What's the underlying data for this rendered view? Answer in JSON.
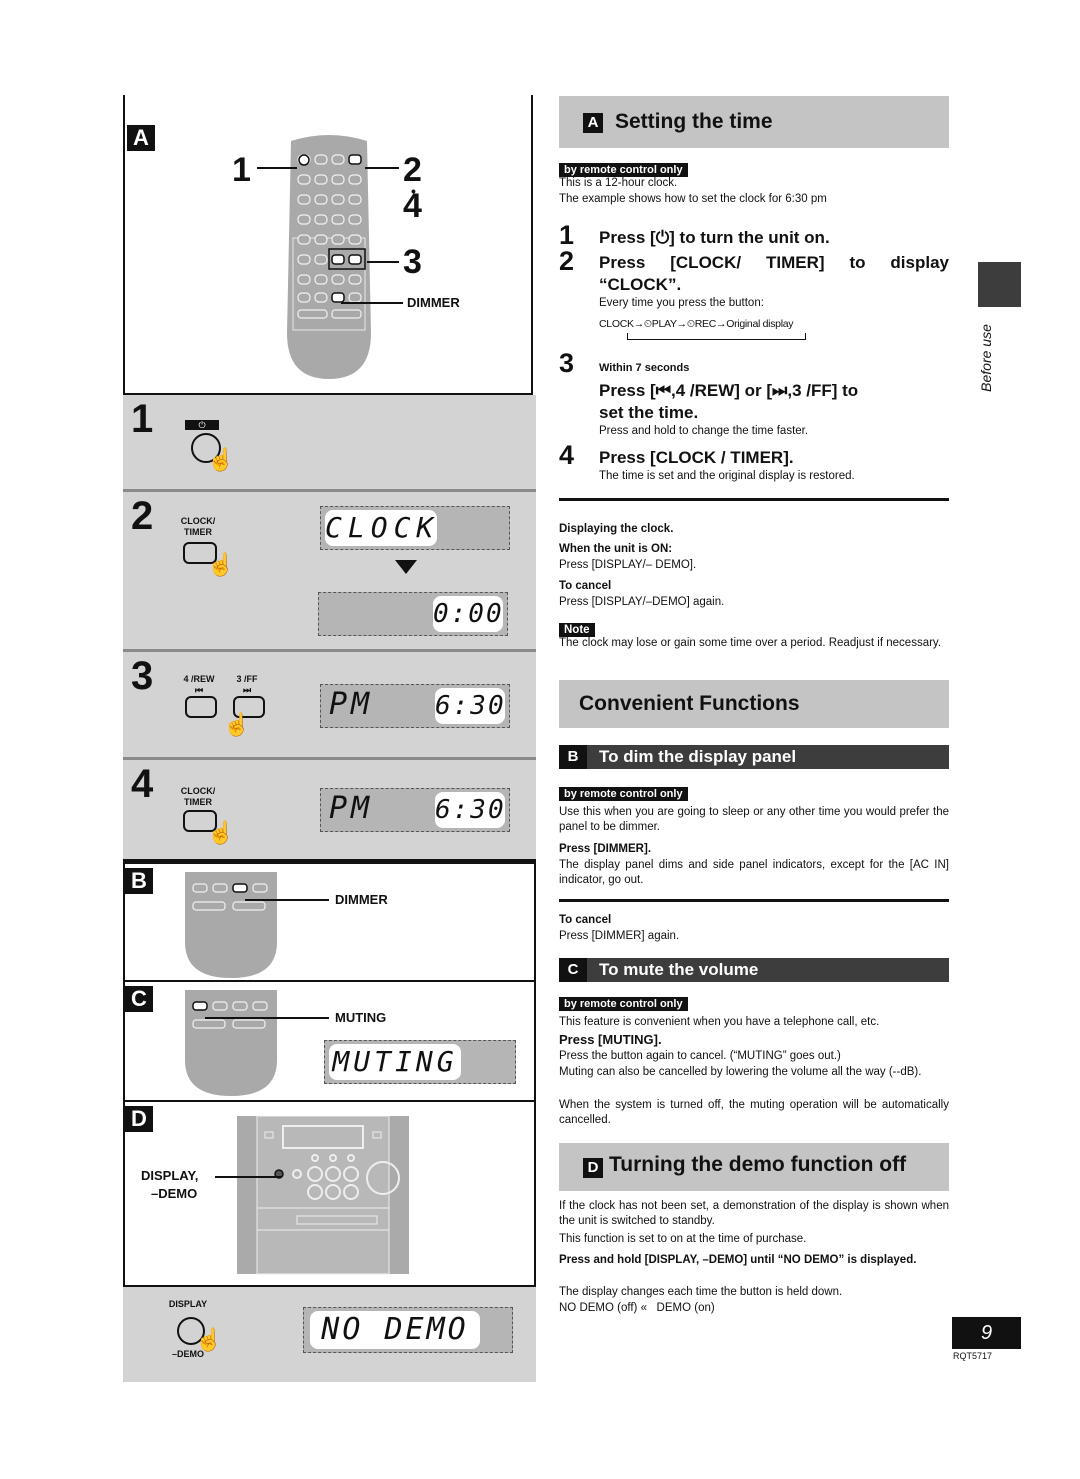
{
  "page": {
    "side_tab": "Before use",
    "page_number": "9",
    "doc_code": "RQT5717"
  },
  "illustrations": {
    "box_a": {
      "letter": "A",
      "callouts": [
        "1",
        "2",
        "4",
        "3"
      ],
      "dimmer_label": "DIMMER",
      "power_symbol": "⏻"
    },
    "steps": [
      {
        "num": "1",
        "button_label": "⏻"
      },
      {
        "num": "2",
        "button_label_line1": "CLOCK/",
        "button_label_line2": "TIMER",
        "display_1": "CLOCK",
        "display_2": "0:00"
      },
      {
        "num": "3",
        "btn_rew_label": "4 /REW",
        "btn_rew_icon": "⏮",
        "btn_ff_label": "3 /FF",
        "btn_ff_icon": "⏭",
        "display_left": "PM",
        "display_right": "6:30"
      },
      {
        "num": "4",
        "button_label_line1": "CLOCK/",
        "button_label_line2": "TIMER",
        "display_left": "PM",
        "display_right": "6:30"
      }
    ],
    "box_b": {
      "letter": "B",
      "callout": "DIMMER"
    },
    "box_c": {
      "letter": "C",
      "callout": "MUTING",
      "display": "MUTING"
    },
    "box_d": {
      "letter": "D",
      "callout_line1": "DISPLAY,",
      "callout_line2": "–DEMO"
    },
    "demo_step": {
      "label_top": "DISPLAY",
      "label_bottom": "–DEMO",
      "display": "NO DEMO"
    }
  },
  "setting_time": {
    "letter": "A",
    "title": "Setting the time",
    "tag": "by remote control only",
    "intro_1": "This is a 12-hour clock.",
    "intro_2": "The example shows how to set the clock for 6:30 pm",
    "step1_num": "1",
    "step1": "Press [⏻] to turn the unit on.",
    "step2_num": "2",
    "step2_a": "Press [CLOCK/ TIMER] to display",
    "step2_b": "“CLOCK”.",
    "step2_note": "Every time you press the button:",
    "cycle": [
      "CLOCK",
      "→",
      "⏲PLAY",
      "→",
      "⏲REC",
      "→",
      "Original display"
    ],
    "step3_num": "3",
    "step3_pre": "Within 7 seconds",
    "step3_a": "Press [⏮,4 /REW] or [⏭,3 /FF] to",
    "step3_b": "set the time.",
    "step3_note": "Press and hold to change the time faster.",
    "step4_num": "4",
    "step4": "Press [CLOCK / TIMER].",
    "step4_note": "The time is set and the original display is restored.",
    "display_clock_title": "Displaying the clock.",
    "when_on_title": "When the unit is ON:",
    "when_on_text": "Press [DISPLAY/– DEMO].",
    "cancel_title": "To cancel",
    "cancel_text": "Press [DISPLAY/–DEMO] again.",
    "note_tag": "Note",
    "note_text": "The clock may lose or gain some time over a period. Readjust if necessary."
  },
  "convenient": {
    "title": "Convenient Functions",
    "dim": {
      "letter": "B",
      "title": "To dim the display panel",
      "tag": "by remote control only",
      "intro": "Use this when you are going to sleep or any other time you would prefer the panel to be dimmer.",
      "press": "Press [DIMMER].",
      "press_text": "The display panel dims and side panel indicators, except for the [AC IN] indicator, go out.",
      "cancel_title": "To cancel",
      "cancel_text": "Press [DIMMER] again."
    },
    "mute": {
      "letter": "C",
      "title": "To mute the volume",
      "tag": "by remote control only",
      "intro": "This feature is convenient when you have a telephone call, etc.",
      "press": "Press [MUTING].",
      "text_1": "Press the button again to cancel. (“MUTING” goes out.)",
      "text_2": "Muting can also be cancelled by lowering the volume all the way (--dB).",
      "text_3": "When the system is turned off, the muting operation will be automatically cancelled."
    }
  },
  "demo": {
    "letter": "D",
    "title": "Turning the demo function off",
    "intro_1": "If the clock has not been set, a demonstration of the display is shown when the unit is switched to standby.",
    "intro_2": "This function is set to on at the time of purchase.",
    "press": "Press and hold [DISPLAY, –DEMO] until “NO DEMO” is displayed.",
    "text_1": "The display changes each time the button is held down.",
    "text_2": "NO DEMO (off) «   DEMO (on)"
  }
}
